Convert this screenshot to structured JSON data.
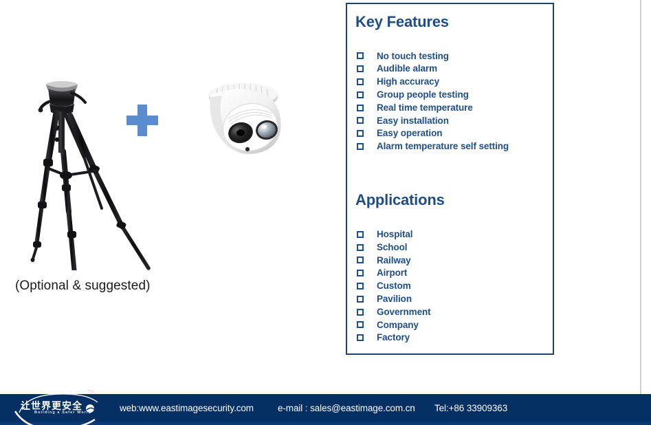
{
  "product": {
    "tripod_alt": "camera-tripod",
    "camera_alt": "dome-security-camera",
    "plus_symbol": "plus-icon",
    "caption": "(Optional & suggested)"
  },
  "panel": {
    "features": {
      "title": "Key Features",
      "items": [
        "No touch testing",
        "Audible alarm",
        "High accuracy",
        "Group people testing",
        "Real time temperature",
        "Easy installation",
        "Easy operation",
        "Alarm temperature self setting"
      ]
    },
    "applications": {
      "title": "Applications",
      "items": [
        "Hospital",
        "School",
        "Railway",
        "Airport",
        "Custom",
        "Pavilion",
        "Government",
        "Company",
        "Factory"
      ]
    }
  },
  "footer": {
    "logo_cn": "让世界更安全",
    "logo_tm": "TM",
    "logo_en": "Building a Safer World",
    "web": "web:www.eastimagesecurity.com",
    "email": "e-mail : sales@eastimage.com.cn",
    "tel": "Tel:+86 33909363"
  },
  "colors": {
    "panel_border": "#1f4371",
    "heading": "#1f4e86",
    "footer_bg": "#042f63",
    "plus": "#5b8ccd"
  }
}
